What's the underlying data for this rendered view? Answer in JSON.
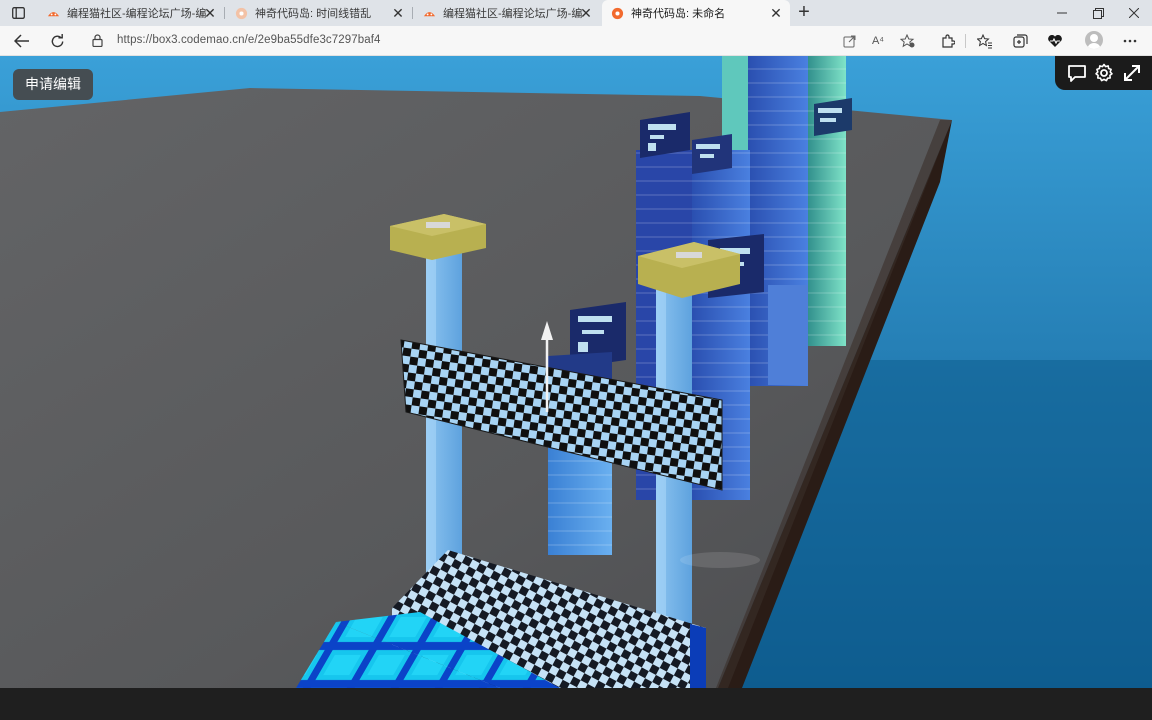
{
  "browser": {
    "tabs": [
      {
        "title": "编程猫社区-编程论坛广场-编程猫",
        "active": false
      },
      {
        "title": "神奇代码岛: 时间线错乱",
        "active": false
      },
      {
        "title": "编程猫社区-编程论坛广场-编程猫",
        "active": false
      },
      {
        "title": "神奇代码岛: 未命名",
        "active": true
      }
    ],
    "url": "https://box3.codemao.cn/e/2e9ba55dfe3c7297baf4",
    "read_aloud_label": "A⁴",
    "icons": {
      "tab_actions": "tab-actions-icon",
      "close_tab": "close-icon",
      "new_tab": "plus-icon",
      "back": "back-arrow-icon",
      "refresh": "refresh-icon",
      "site_info": "lock-icon",
      "open_app": "open-in-app-icon",
      "favorite": "star-add-icon",
      "extensions": "puzzle-icon",
      "favorites": "favorites-icon",
      "collections": "collections-icon",
      "health": "heart-icon",
      "profile": "profile-icon",
      "more": "more-icon"
    },
    "colors": {
      "tabstrip": "#dfe3e8",
      "active_tab": "#f7f7f7",
      "codemao_orange": "#f26a2e"
    }
  },
  "editor": {
    "request_edit_label": "申请编辑",
    "toolbar_icons": [
      "chat-icon",
      "settings-gear-icon",
      "fullscreen-icon"
    ]
  }
}
